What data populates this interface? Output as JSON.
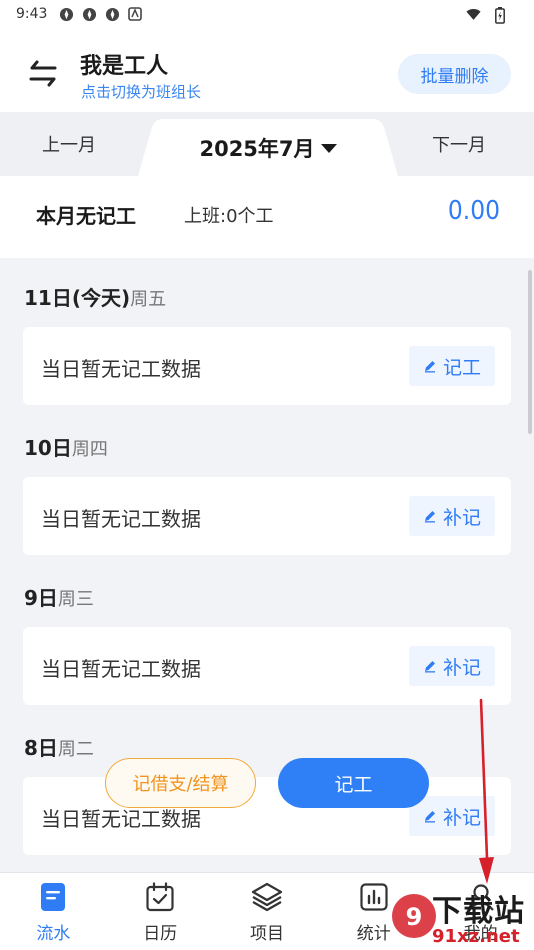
{
  "status_bar": {
    "time": "9:43"
  },
  "header": {
    "title": "我是工人",
    "subtitle": "点击切换为班组长",
    "batch_delete": "批量删除"
  },
  "month_nav": {
    "prev": "上一月",
    "current": "2025年7月",
    "next": "下一月"
  },
  "summary": {
    "title": "本月无记工",
    "work": "上班:0个工",
    "amount": "0.00"
  },
  "days": [
    {
      "day": "11日(今天)",
      "weekday": "周五",
      "empty_text": "当日暂无记工数据",
      "action": "记工"
    },
    {
      "day": "10日",
      "weekday": "周四",
      "empty_text": "当日暂无记工数据",
      "action": "补记"
    },
    {
      "day": "9日",
      "weekday": "周三",
      "empty_text": "当日暂无记工数据",
      "action": "补记"
    },
    {
      "day": "8日",
      "weekday": "周二",
      "empty_text": "当日暂无记工数据",
      "action": "补记"
    }
  ],
  "fab": {
    "loan": "记借支/结算",
    "record": "记工"
  },
  "tabs": [
    {
      "label": "流水",
      "icon": "document-icon",
      "active": true
    },
    {
      "label": "日历",
      "icon": "calendar-icon",
      "active": false
    },
    {
      "label": "项目",
      "icon": "layers-icon",
      "active": false
    },
    {
      "label": "统计",
      "icon": "chart-icon",
      "active": false
    },
    {
      "label": "我的",
      "icon": "user-icon",
      "active": false
    }
  ],
  "watermark": {
    "text1": "下载站",
    "text2": "91xz.net"
  },
  "colors": {
    "accent": "#2f7cf5",
    "orange": "#f0941f",
    "arrow": "#d6202a"
  }
}
